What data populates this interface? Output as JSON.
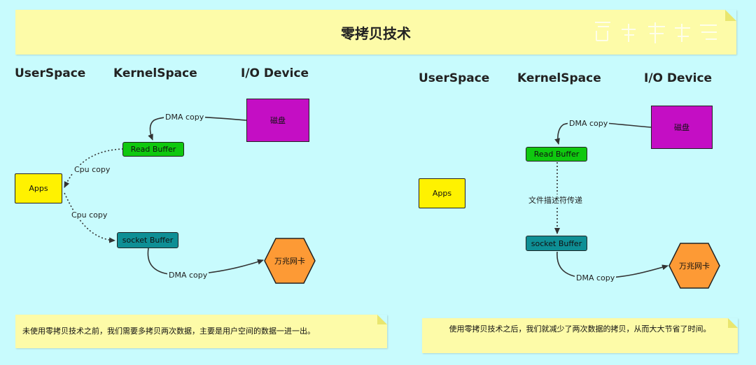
{
  "title": "零拷贝技术",
  "left": {
    "headers": {
      "user": "UserSpace",
      "kernel": "KernelSpace",
      "io": "I/O Device"
    },
    "disk": "磁盘",
    "read_buffer": "Read  Buffer",
    "socket_buffer": "socket  Buffer",
    "apps": "Apps",
    "nic": "万兆网卡",
    "edge_dma_in": "DMA copy",
    "edge_cpu_1": "Cpu copy",
    "edge_cpu_2": "Cpu copy",
    "edge_dma_out": "DMA copy",
    "note": "未使用零拷贝技术之前，我们需要多拷贝两次数据，主要是用户空间的数据一进一出。"
  },
  "right": {
    "headers": {
      "user": "UserSpace",
      "kernel": "KernelSpace",
      "io": "I/O Device"
    },
    "disk": "磁盘",
    "read_buffer": "Read  Buffer",
    "socket_buffer": "socket  Buffer",
    "apps": "Apps",
    "nic": "万兆网卡",
    "edge_dma_in": "DMA copy",
    "edge_fd": "文件描述符传递",
    "edge_dma_out": "DMA copy",
    "note": "使用零拷贝技术之后，我们就减少了两次数据的拷贝，从而大大节省了时间。"
  },
  "colors": {
    "background": "#c8fbfd",
    "note": "#fdfba8",
    "disk": "#c40ec4",
    "read_buffer": "#0fc80f",
    "socket_buffer": "#0e8f95",
    "apps": "#fff200",
    "nic": "#fd9a35"
  }
}
